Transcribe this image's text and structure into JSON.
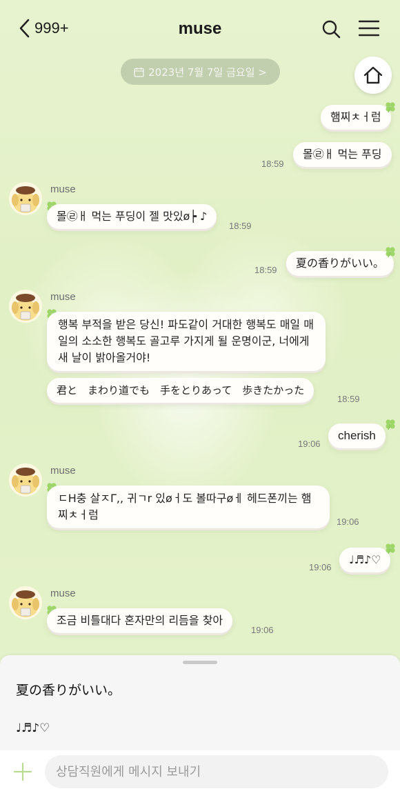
{
  "header": {
    "back_count": "999+",
    "title": "muse"
  },
  "date_pill": "2023년 7월 7일 금요일 >",
  "messages": [
    {
      "side": "right",
      "text": "햄찌ㅊㅓ럼",
      "time": ""
    },
    {
      "side": "right",
      "text": "몰㉣ㅐ 먹는 푸딩",
      "time": "18:59"
    },
    {
      "side": "left",
      "sender": "muse",
      "text": "몰㉣ㅐ 먹는 푸딩이 젤 맛있ø┝ ♪",
      "time": "18:59"
    },
    {
      "side": "right",
      "text": "夏の香りがいい。",
      "time": "18:59"
    },
    {
      "side": "left",
      "sender": "muse",
      "text": "행복 부적을 받은 당신! 파도같이 거대한 행복도 매일 매일의 소소한 행복도 골고루 가지게 될 운명이군, 너에게 새 날이 밝아올거야!",
      "time": ""
    },
    {
      "side": "left",
      "text": "君と　まわり道でも　手をとりあって　歩きたかった",
      "time": "18:59"
    },
    {
      "side": "right",
      "text": "cherish",
      "time": "19:06"
    },
    {
      "side": "left",
      "sender": "muse",
      "text": "ㄷH충 살ㅈΓ,, 귀ㄱr 있øㅓ도 볼따구øㅔ 헤드폰끼는 햄찌ㅊㅓ럼",
      "time": "19:06"
    },
    {
      "side": "right",
      "text": "♩♬♪♡",
      "time": "19:06"
    },
    {
      "side": "left",
      "sender": "muse",
      "text": "조금 비틀대다 혼자만의 리듬을 찾아",
      "time": "19:06"
    }
  ],
  "panel": {
    "preview_line1": "夏の香りがいい。",
    "preview_line2": "♩♬♪♡"
  },
  "composer": {
    "placeholder": "상담직원에게 메시지 보내기"
  },
  "colors": {
    "background": "#e3f1c8",
    "bubble": "#fffefb",
    "clover": "#9ed66a"
  }
}
